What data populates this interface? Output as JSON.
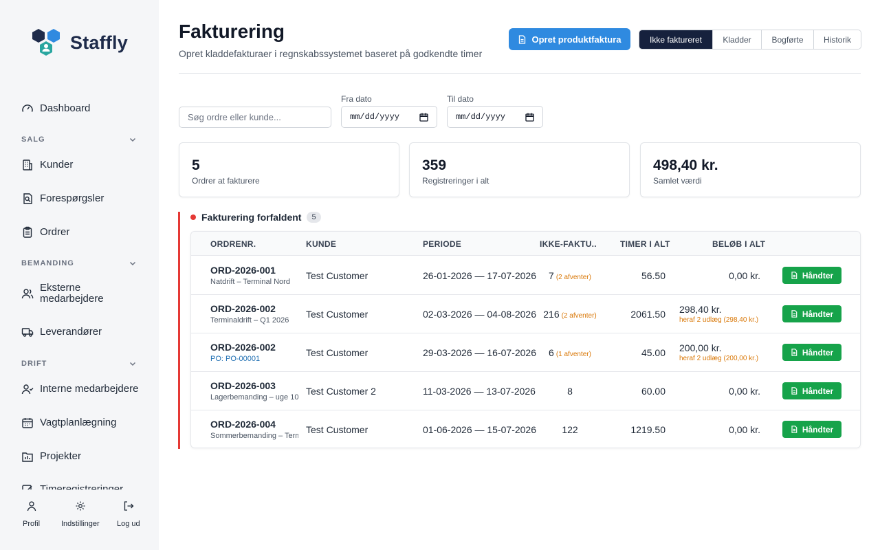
{
  "brand": {
    "name": "Staffly",
    "colors": {
      "primary": "#2f8ae0",
      "success": "#16a34a",
      "danger": "#e53935",
      "warning": "#d97706",
      "navy": "#16213d"
    }
  },
  "sidebar": {
    "dashboard": "Dashboard",
    "sections": [
      {
        "title": "SALG",
        "items": [
          "Kunder",
          "Forespørgsler",
          "Ordrer"
        ]
      },
      {
        "title": "BEMANDING",
        "items": [
          "Eksterne medarbejdere",
          "Leverandører"
        ]
      },
      {
        "title": "DRIFT",
        "items": [
          "Interne medarbejdere",
          "Vagtplanlægning",
          "Projekter",
          "Timeregistreringer"
        ]
      }
    ],
    "bottom": {
      "profile": "Profil",
      "settings": "Indstillinger",
      "logout": "Log ud"
    }
  },
  "header": {
    "title": "Fakturering",
    "subtitle": "Opret kladdefakturaer i regnskabssystemet baseret på godkendte timer",
    "primary_button": "Opret produktfaktura",
    "tabs": [
      "Ikke faktureret",
      "Kladder",
      "Bogførte",
      "Historik"
    ],
    "active_tab": "Ikke faktureret"
  },
  "filters": {
    "search_placeholder": "Søg ordre eller kunde...",
    "from_label": "Fra dato",
    "to_label": "Til dato",
    "date_placeholder": "mm/dd/yyyy"
  },
  "stats": [
    {
      "value": "5",
      "label": "Ordrer at fakturere"
    },
    {
      "value": "359",
      "label": "Registreringer i alt"
    },
    {
      "value": "498,40 kr.",
      "label": "Samlet værdi"
    }
  ],
  "group": {
    "title": "Fakturering forfaldent",
    "count": "5",
    "columns": [
      "ORDRENR.",
      "KUNDE",
      "PERIODE",
      "IKKE-FAKTU...",
      "TIMER I ALT",
      "BELØB I ALT"
    ],
    "handle_label": "Håndter",
    "rows": [
      {
        "order": "ORD-2026-001",
        "sub": "Natdrift – Terminal Nord",
        "customer": "Test Customer",
        "period": "26-01-2026 — 17-07-2026",
        "unbilled": "7",
        "pending": "(2 afventer)",
        "hours": "56.50",
        "amount": "0,00 kr.",
        "amount_note": ""
      },
      {
        "order": "ORD-2026-002",
        "sub": "Terminaldrift – Q1 2026",
        "customer": "Test Customer",
        "period": "02-03-2026 — 04-08-2026",
        "unbilled": "216",
        "pending": "(2 afventer)",
        "hours": "2061.50",
        "amount": "298,40 kr.",
        "amount_note": "heraf 2 udlæg (298,40 kr.)"
      },
      {
        "order": "ORD-2026-002",
        "sub": "PO: PO-00001",
        "customer": "Test Customer",
        "period": "29-03-2026 — 16-07-2026",
        "unbilled": "6",
        "pending": "(1 afventer)",
        "hours": "45.00",
        "amount": "200,00 kr.",
        "amount_note": "heraf 2 udlæg (200,00 kr.)"
      },
      {
        "order": "ORD-2026-003",
        "sub": "Lagerbemanding – uge 10",
        "customer": "Test Customer 2",
        "period": "11-03-2026 — 13-07-2026",
        "unbilled": "8",
        "pending": "",
        "hours": "60.00",
        "amount": "0,00 kr.",
        "amount_note": ""
      },
      {
        "order": "ORD-2026-004",
        "sub": "Sommerbemanding – Terminal",
        "customer": "Test Customer",
        "period": "01-06-2026 — 15-07-2026",
        "unbilled": "122",
        "pending": "",
        "hours": "1219.50",
        "amount": "0,00 kr.",
        "amount_note": ""
      }
    ]
  }
}
